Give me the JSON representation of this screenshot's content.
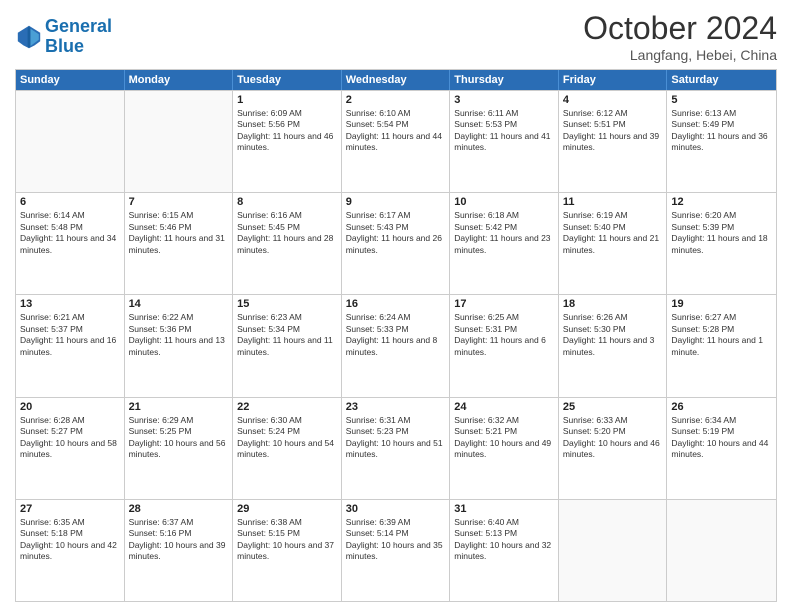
{
  "header": {
    "logo_line1": "General",
    "logo_line2": "Blue",
    "month": "October 2024",
    "location": "Langfang, Hebei, China"
  },
  "weekdays": [
    "Sunday",
    "Monday",
    "Tuesday",
    "Wednesday",
    "Thursday",
    "Friday",
    "Saturday"
  ],
  "rows": [
    [
      {
        "day": "",
        "info": ""
      },
      {
        "day": "",
        "info": ""
      },
      {
        "day": "1",
        "info": "Sunrise: 6:09 AM\nSunset: 5:56 PM\nDaylight: 11 hours and 46 minutes."
      },
      {
        "day": "2",
        "info": "Sunrise: 6:10 AM\nSunset: 5:54 PM\nDaylight: 11 hours and 44 minutes."
      },
      {
        "day": "3",
        "info": "Sunrise: 6:11 AM\nSunset: 5:53 PM\nDaylight: 11 hours and 41 minutes."
      },
      {
        "day": "4",
        "info": "Sunrise: 6:12 AM\nSunset: 5:51 PM\nDaylight: 11 hours and 39 minutes."
      },
      {
        "day": "5",
        "info": "Sunrise: 6:13 AM\nSunset: 5:49 PM\nDaylight: 11 hours and 36 minutes."
      }
    ],
    [
      {
        "day": "6",
        "info": "Sunrise: 6:14 AM\nSunset: 5:48 PM\nDaylight: 11 hours and 34 minutes."
      },
      {
        "day": "7",
        "info": "Sunrise: 6:15 AM\nSunset: 5:46 PM\nDaylight: 11 hours and 31 minutes."
      },
      {
        "day": "8",
        "info": "Sunrise: 6:16 AM\nSunset: 5:45 PM\nDaylight: 11 hours and 28 minutes."
      },
      {
        "day": "9",
        "info": "Sunrise: 6:17 AM\nSunset: 5:43 PM\nDaylight: 11 hours and 26 minutes."
      },
      {
        "day": "10",
        "info": "Sunrise: 6:18 AM\nSunset: 5:42 PM\nDaylight: 11 hours and 23 minutes."
      },
      {
        "day": "11",
        "info": "Sunrise: 6:19 AM\nSunset: 5:40 PM\nDaylight: 11 hours and 21 minutes."
      },
      {
        "day": "12",
        "info": "Sunrise: 6:20 AM\nSunset: 5:39 PM\nDaylight: 11 hours and 18 minutes."
      }
    ],
    [
      {
        "day": "13",
        "info": "Sunrise: 6:21 AM\nSunset: 5:37 PM\nDaylight: 11 hours and 16 minutes."
      },
      {
        "day": "14",
        "info": "Sunrise: 6:22 AM\nSunset: 5:36 PM\nDaylight: 11 hours and 13 minutes."
      },
      {
        "day": "15",
        "info": "Sunrise: 6:23 AM\nSunset: 5:34 PM\nDaylight: 11 hours and 11 minutes."
      },
      {
        "day": "16",
        "info": "Sunrise: 6:24 AM\nSunset: 5:33 PM\nDaylight: 11 hours and 8 minutes."
      },
      {
        "day": "17",
        "info": "Sunrise: 6:25 AM\nSunset: 5:31 PM\nDaylight: 11 hours and 6 minutes."
      },
      {
        "day": "18",
        "info": "Sunrise: 6:26 AM\nSunset: 5:30 PM\nDaylight: 11 hours and 3 minutes."
      },
      {
        "day": "19",
        "info": "Sunrise: 6:27 AM\nSunset: 5:28 PM\nDaylight: 11 hours and 1 minute."
      }
    ],
    [
      {
        "day": "20",
        "info": "Sunrise: 6:28 AM\nSunset: 5:27 PM\nDaylight: 10 hours and 58 minutes."
      },
      {
        "day": "21",
        "info": "Sunrise: 6:29 AM\nSunset: 5:25 PM\nDaylight: 10 hours and 56 minutes."
      },
      {
        "day": "22",
        "info": "Sunrise: 6:30 AM\nSunset: 5:24 PM\nDaylight: 10 hours and 54 minutes."
      },
      {
        "day": "23",
        "info": "Sunrise: 6:31 AM\nSunset: 5:23 PM\nDaylight: 10 hours and 51 minutes."
      },
      {
        "day": "24",
        "info": "Sunrise: 6:32 AM\nSunset: 5:21 PM\nDaylight: 10 hours and 49 minutes."
      },
      {
        "day": "25",
        "info": "Sunrise: 6:33 AM\nSunset: 5:20 PM\nDaylight: 10 hours and 46 minutes."
      },
      {
        "day": "26",
        "info": "Sunrise: 6:34 AM\nSunset: 5:19 PM\nDaylight: 10 hours and 44 minutes."
      }
    ],
    [
      {
        "day": "27",
        "info": "Sunrise: 6:35 AM\nSunset: 5:18 PM\nDaylight: 10 hours and 42 minutes."
      },
      {
        "day": "28",
        "info": "Sunrise: 6:37 AM\nSunset: 5:16 PM\nDaylight: 10 hours and 39 minutes."
      },
      {
        "day": "29",
        "info": "Sunrise: 6:38 AM\nSunset: 5:15 PM\nDaylight: 10 hours and 37 minutes."
      },
      {
        "day": "30",
        "info": "Sunrise: 6:39 AM\nSunset: 5:14 PM\nDaylight: 10 hours and 35 minutes."
      },
      {
        "day": "31",
        "info": "Sunrise: 6:40 AM\nSunset: 5:13 PM\nDaylight: 10 hours and 32 minutes."
      },
      {
        "day": "",
        "info": ""
      },
      {
        "day": "",
        "info": ""
      }
    ]
  ]
}
